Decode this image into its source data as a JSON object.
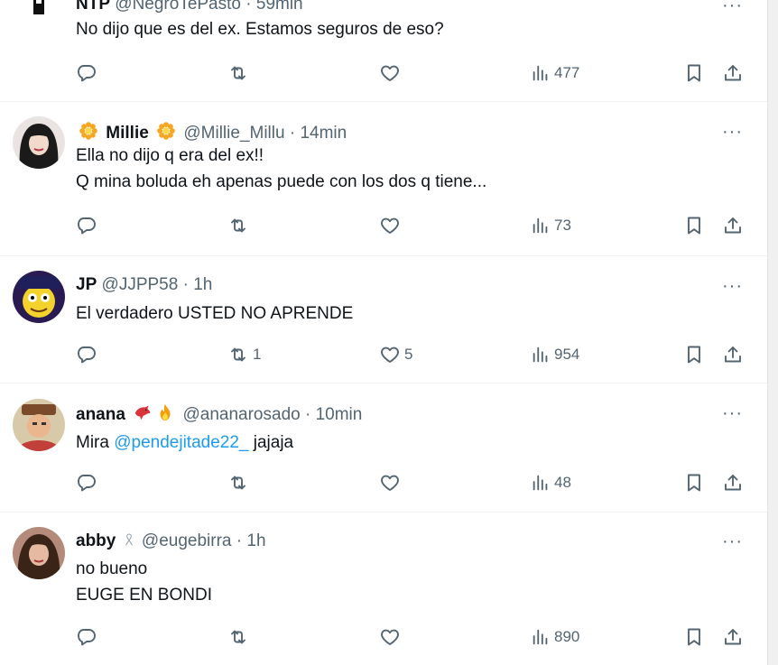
{
  "tweets": [
    {
      "name": "NTP",
      "handle": "@NegroTePasto",
      "dot": "·",
      "time": "59min",
      "lines": [
        "No dijo que es del ex. Estamos seguros de eso?"
      ],
      "reply_count": "",
      "retweet_count": "",
      "like_count": "",
      "views": "477",
      "icons": {
        "reply": "reply-icon",
        "retweet": "retweet-icon",
        "like": "heart-icon",
        "views": "views-chart-icon",
        "bookmark": "bookmark-icon",
        "share": "share-icon"
      }
    },
    {
      "name": "Millie",
      "name_emojis": [
        "sunflower",
        "sunflower"
      ],
      "handle": "@Millie_Millu",
      "dot": "·",
      "time": "14min",
      "lines": [
        "Ella no dijo q era del ex!!",
        "Q mina boluda eh apenas puede con los dos q tiene..."
      ],
      "reply_count": "",
      "retweet_count": "",
      "like_count": "",
      "views": "73"
    },
    {
      "name": "JP",
      "handle": "@JJPP58",
      "dot": "·",
      "time": "1h",
      "lines": [
        "El verdadero USTED NO APRENDE"
      ],
      "reply_count": "",
      "retweet_count": "1",
      "like_count": "5",
      "views": "954"
    },
    {
      "name": "anana",
      "name_emojis": [
        "bird",
        "fire"
      ],
      "handle": "@ananarosado",
      "dot": "·",
      "time": "10min",
      "text_prefix": "Mira ",
      "mention": "@pendejitade22_",
      "text_suffix": " jajaja",
      "reply_count": "",
      "retweet_count": "",
      "like_count": "",
      "views": "48"
    },
    {
      "name": "abby",
      "name_emojis": [
        "ribbon"
      ],
      "handle": "@eugebirra",
      "dot": "·",
      "time": "1h",
      "lines": [
        "no bueno",
        "EUGE EN BONDI"
      ],
      "reply_count": "",
      "retweet_count": "",
      "like_count": "",
      "views": "890"
    }
  ],
  "more_label": "···",
  "colors": {
    "text": "#0f1419",
    "secondary": "#536471",
    "link": "#1d9bf0",
    "divider": "#eff3f4"
  }
}
